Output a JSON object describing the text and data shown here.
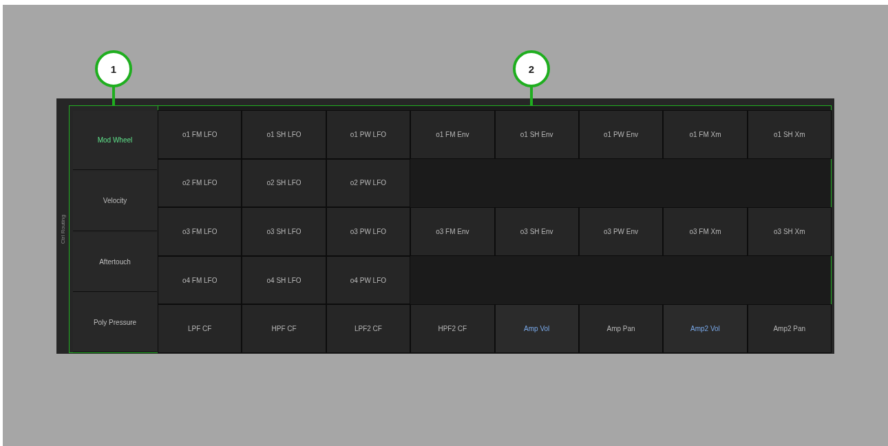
{
  "callouts": [
    {
      "label": "1"
    },
    {
      "label": "2"
    }
  ],
  "panel": {
    "title": "Ctrl Routing",
    "sources": [
      {
        "label": "Mod Wheel",
        "selected": true
      },
      {
        "label": "Velocity",
        "selected": false
      },
      {
        "label": "Aftertouch",
        "selected": false
      },
      {
        "label": "Poly Pressure",
        "selected": false
      }
    ],
    "target_rows": [
      {
        "cells": [
          {
            "label": "o1 FM LFO",
            "active": false
          },
          {
            "label": "o1 SH LFO",
            "active": false
          },
          {
            "label": "o1 PW LFO",
            "active": false
          },
          {
            "label": "o1 FM Env",
            "active": false
          },
          {
            "label": "o1 SH Env",
            "active": false
          },
          {
            "label": "o1 PW Env",
            "active": false
          },
          {
            "label": "o1 FM Xm",
            "active": false
          },
          {
            "label": "o1 SH Xm",
            "active": false
          }
        ]
      },
      {
        "cells": [
          {
            "label": "o2 FM LFO",
            "active": false
          },
          {
            "label": "o2 SH LFO",
            "active": false
          },
          {
            "label": "o2 PW LFO",
            "active": false
          }
        ]
      },
      {
        "cells": [
          {
            "label": "o3 FM LFO",
            "active": false
          },
          {
            "label": "o3 SH LFO",
            "active": false
          },
          {
            "label": "o3 PW LFO",
            "active": false
          },
          {
            "label": "o3 FM Env",
            "active": false
          },
          {
            "label": "o3 SH Env",
            "active": false
          },
          {
            "label": "o3 PW Env",
            "active": false
          },
          {
            "label": "o3 FM Xm",
            "active": false
          },
          {
            "label": "o3 SH Xm",
            "active": false
          }
        ]
      },
      {
        "cells": [
          {
            "label": "o4 FM LFO",
            "active": false
          },
          {
            "label": "o4 SH LFO",
            "active": false
          },
          {
            "label": "o4 PW LFO",
            "active": false
          }
        ]
      },
      {
        "cells": [
          {
            "label": "LPF CF",
            "active": false
          },
          {
            "label": "HPF CF",
            "active": false
          },
          {
            "label": "LPF2 CF",
            "active": false
          },
          {
            "label": "HPF2 CF",
            "active": false
          },
          {
            "label": "Amp Vol",
            "active": true
          },
          {
            "label": "Amp Pan",
            "active": false
          },
          {
            "label": "Amp2 Vol",
            "active": true
          },
          {
            "label": "Amp2 Pan",
            "active": false
          }
        ]
      }
    ]
  }
}
